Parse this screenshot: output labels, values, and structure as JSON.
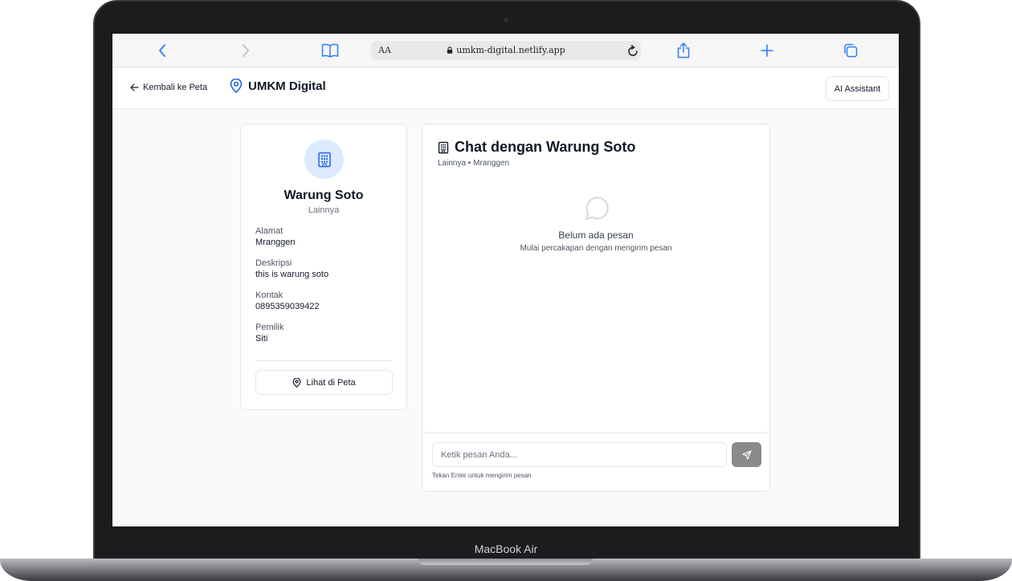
{
  "device": {
    "label": "MacBook Air"
  },
  "browser": {
    "reader_label": "AA",
    "url": "umkm-digital.netlify.app"
  },
  "header": {
    "back_label": "Kembali ke Peta",
    "brand": "UMKM Digital",
    "ai_button": "AI Assistant"
  },
  "business": {
    "name": "Warung Soto",
    "category": "Lainnya",
    "fields": [
      {
        "label": "Alamat",
        "value": "Mranggen"
      },
      {
        "label": "Deskripsi",
        "value": "this is warung soto"
      },
      {
        "label": "Kontak",
        "value": "0895359039422"
      },
      {
        "label": "Pemilik",
        "value": "Siti"
      }
    ],
    "map_button": "Lihat di Peta"
  },
  "chat": {
    "title": "Chat dengan Warung Soto",
    "subtitle": "Lainnya • Mranggen",
    "empty_title": "Belum ada pesan",
    "empty_subtitle": "Mulai percakapan dengan mengirim pesan",
    "input_placeholder": "Ketik pesan Anda...",
    "input_value": "",
    "hint": "Tekan Enter untuk mengirim pesan"
  },
  "colors": {
    "accent": "#2563eb",
    "avatar_bg": "#dbeafe",
    "send_button": "#8a8a8a",
    "safari_blue": "#2f7cf6"
  }
}
